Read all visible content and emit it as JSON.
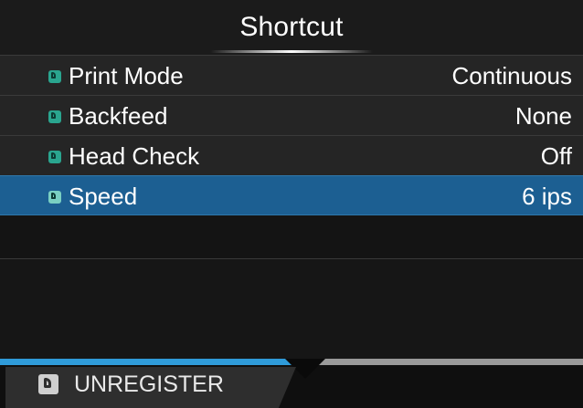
{
  "header": {
    "title": "Shortcut"
  },
  "menu": {
    "items": [
      {
        "label": "Print Mode",
        "value": "Continuous",
        "selected": false
      },
      {
        "label": "Backfeed",
        "value": "None",
        "selected": false
      },
      {
        "label": "Head Check",
        "value": "Off",
        "selected": false
      },
      {
        "label": "Speed",
        "value": "6 ips",
        "selected": true
      }
    ]
  },
  "softkeys": {
    "left_label": "UNREGISTER"
  },
  "colors": {
    "selection": "#1c5f92",
    "accent_bar": "#2f9bd9",
    "bullet": "#2aa58f"
  }
}
